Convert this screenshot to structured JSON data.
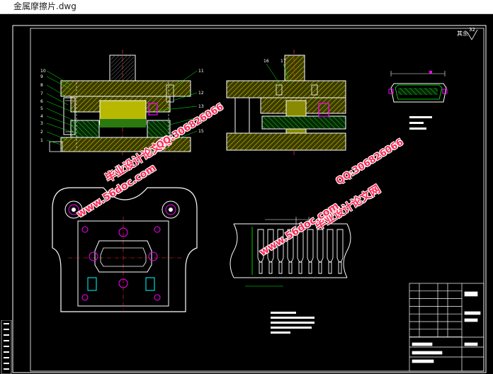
{
  "window": {
    "title": "金属摩擦片.dwg"
  },
  "drawing": {
    "surface_mark": "32",
    "surface_prefix": "其余",
    "part_numbers_left": [
      "10",
      "9",
      "8",
      "7",
      "6",
      "5",
      "4",
      "3",
      "2",
      "1"
    ],
    "part_numbers_right": [
      "11",
      "12",
      "13",
      "14",
      "15"
    ],
    "part_numbers_mid": [
      "16",
      "17"
    ]
  },
  "watermarks": [
    {
      "text": "毕业设计论文网"
    },
    {
      "text": "www.56doc.com"
    },
    {
      "text": "QQ:306826066"
    },
    {
      "text": "毕业设计论文网"
    },
    {
      "text": "www.56doc.com"
    },
    {
      "text": "QQ:306826066"
    }
  ],
  "colors": {
    "background": "#000000",
    "line": "#ffffff",
    "hatch": "#ffff00",
    "green": "#00ff00",
    "accent": "#ff00ff",
    "watermark": "#ff2a55"
  }
}
